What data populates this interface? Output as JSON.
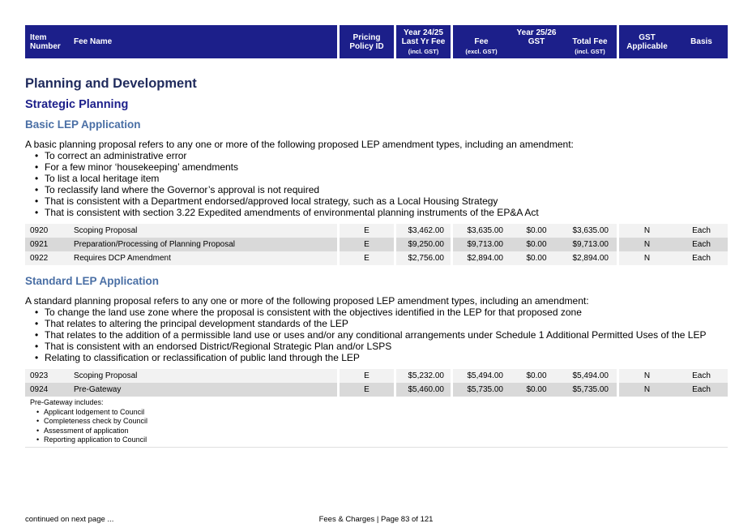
{
  "header": {
    "item_number": [
      "Item",
      "Number"
    ],
    "fee_name": "Fee Name",
    "pricing_policy": [
      "Pricing",
      "Policy ID"
    ],
    "year_prev": "Year 24/25",
    "last_yr_fee": "Last Yr Fee",
    "incl_gst_1": "(incl. GST)",
    "year_curr": "Year 25/26",
    "fee": "Fee",
    "excl_gst": "(excl. GST)",
    "gst": "GST",
    "total_fee": "Total Fee",
    "incl_gst_2": "(incl. GST)",
    "gst_applicable": [
      "GST",
      "Applicable"
    ],
    "basis": "Basis"
  },
  "section_title": "Planning and Development",
  "subsection_title": "Strategic Planning",
  "groups": {
    "basic": {
      "title": "Basic LEP Application",
      "intro": "A basic planning proposal refers to any one or more of the following proposed LEP amendment types, including an amendment:",
      "bullets": [
        "To correct an administrative error",
        "For a few minor ‘housekeeping’ amendments",
        "To list a local heritage item",
        "To reclassify land where the Governor’s approval is not required",
        "That is consistent with a Department endorsed/approved local strategy, such as a Local Housing Strategy",
        "That is consistent with section 3.22 Expedited amendments of environmental planning instruments of the EP&A Act"
      ],
      "rows": [
        {
          "item": "0920",
          "name": "Scoping Proposal",
          "policy": "E",
          "last": "$3,462.00",
          "fee": "$3,635.00",
          "gst": "$0.00",
          "total": "$3,635.00",
          "gst_app": "N",
          "basis": "Each"
        },
        {
          "item": "0921",
          "name": "Preparation/Processing of Planning Proposal",
          "policy": "E",
          "last": "$9,250.00",
          "fee": "$9,713.00",
          "gst": "$0.00",
          "total": "$9,713.00",
          "gst_app": "N",
          "basis": "Each"
        },
        {
          "item": "0922",
          "name": "Requires DCP Amendment",
          "policy": "E",
          "last": "$2,756.00",
          "fee": "$2,894.00",
          "gst": "$0.00",
          "total": "$2,894.00",
          "gst_app": "N",
          "basis": "Each"
        }
      ]
    },
    "standard": {
      "title": "Standard LEP Application",
      "intro": "A standard planning proposal refers to any one or more of the following proposed LEP amendment types, including an amendment:",
      "bullets": [
        "To change the land use zone where the proposal is consistent with the objectives identified in the LEP for that proposed zone",
        "That relates to altering the principal development standards of the LEP",
        "That relates to the addition of a permissible land use or uses and/or any conditional arrangements under Schedule 1 Additional Permitted Uses of the LEP",
        "That is consistent with an endorsed District/Regional Strategic Plan and/or LSPS",
        "Relating to classification or reclassification of public land through the LEP"
      ],
      "rows": [
        {
          "item": "0923",
          "name": "Scoping Proposal",
          "policy": "E",
          "last": "$5,232.00",
          "fee": "$5,494.00",
          "gst": "$0.00",
          "total": "$5,494.00",
          "gst_app": "N",
          "basis": "Each"
        },
        {
          "item": "0924",
          "name": "Pre-Gateway",
          "policy": "E",
          "last": "$5,460.00",
          "fee": "$5,735.00",
          "gst": "$0.00",
          "total": "$5,735.00",
          "gst_app": "N",
          "basis": "Each"
        }
      ],
      "note": {
        "heading": "Pre-Gateway includes:",
        "items": [
          "Applicant lodgement to Council",
          "Completeness check by Council",
          "Assessment of application",
          "Reporting application to Council"
        ]
      }
    }
  },
  "footer": {
    "continued": "continued on next page ...",
    "page": "Fees & Charges | Page 83 of 121"
  }
}
